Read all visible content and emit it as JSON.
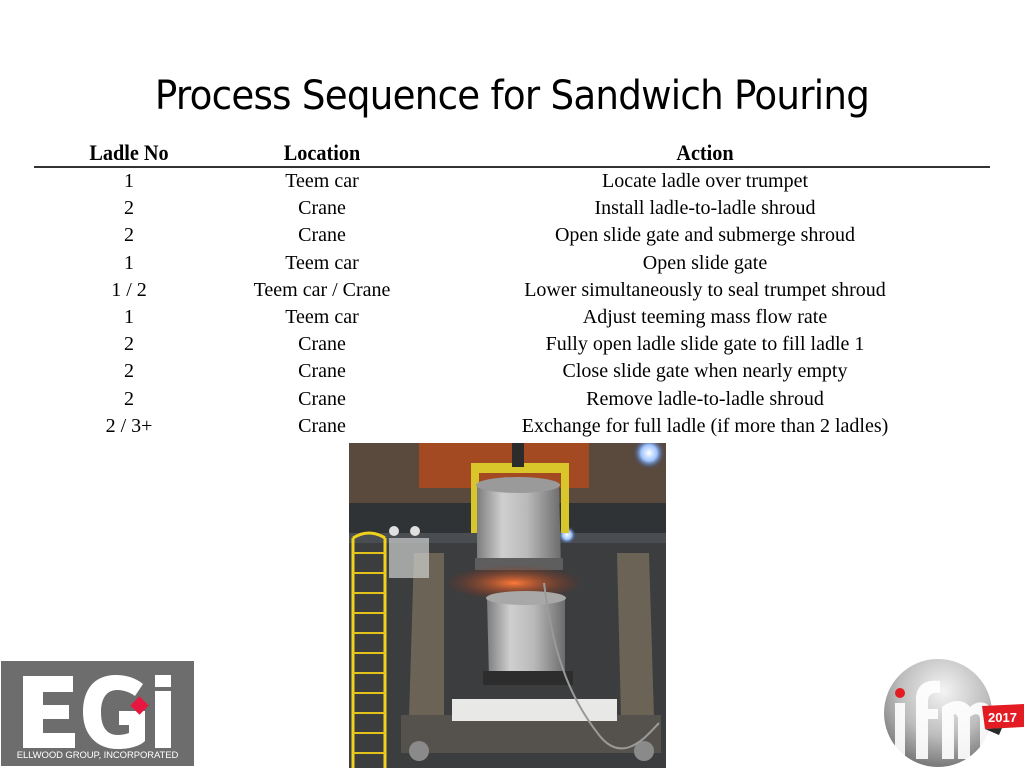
{
  "slide": {
    "title": "Process Sequence for Sandwich Pouring"
  },
  "table": {
    "headers": {
      "ladle_no": "Ladle No",
      "location": "Location",
      "action": "Action"
    },
    "rows": [
      {
        "ladle_no": "1",
        "location": "Teem car",
        "action": "Locate ladle over trumpet"
      },
      {
        "ladle_no": "2",
        "location": "Crane",
        "action": "Install ladle-to-ladle shroud"
      },
      {
        "ladle_no": "2",
        "location": "Crane",
        "action": "Open slide gate and submerge shroud"
      },
      {
        "ladle_no": "1",
        "location": "Teem car",
        "action": "Open slide gate"
      },
      {
        "ladle_no": "1 / 2",
        "location": "Teem car / Crane",
        "action": "Lower simultaneously to seal trumpet shroud"
      },
      {
        "ladle_no": "1",
        "location": "Teem car",
        "action": "Adjust teeming mass flow rate"
      },
      {
        "ladle_no": "2",
        "location": "Crane",
        "action": "Fully open ladle slide gate to fill ladle 1"
      },
      {
        "ladle_no": "2",
        "location": "Crane",
        "action": "Close slide gate when nearly empty"
      },
      {
        "ladle_no": "2",
        "location": "Crane",
        "action": "Remove ladle-to-ladle shroud"
      },
      {
        "ladle_no": "2 / 3+",
        "location": "Crane",
        "action": "Exchange for full ladle (if more than 2 ladles)"
      }
    ]
  },
  "photo": {
    "description": "Two stacked ladles during sandwich pouring on a teem car with yellow ladder",
    "icon": "ladle-photo"
  },
  "logos": {
    "egi": {
      "mark": "EGI",
      "caption": "ELLWOOD GROUP, INCORPORATED",
      "accent_color": "#e8173f",
      "background_color": "#6d6d6d"
    },
    "ifm": {
      "mark": "ifm",
      "year": "2017",
      "accent_color": "#e31b23"
    }
  }
}
